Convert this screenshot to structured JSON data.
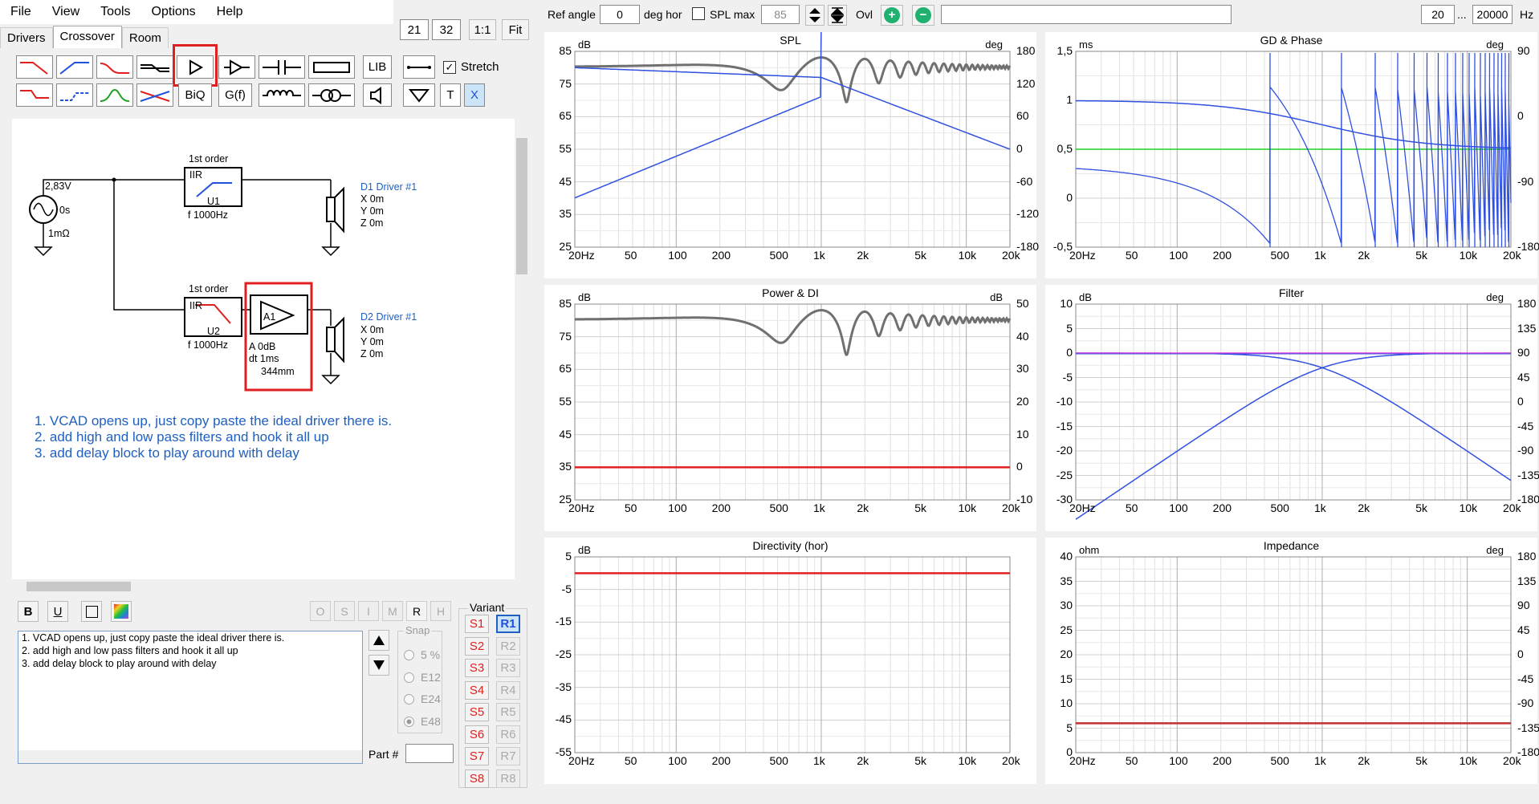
{
  "menu": [
    "File",
    "View",
    "Tools",
    "Options",
    "Help"
  ],
  "tabs": [
    "Drivers",
    "Crossover",
    "Room"
  ],
  "zoom": {
    "a": "21",
    "b": "32",
    "ratio": "1:1",
    "fit": "Fit"
  },
  "toolbar": {
    "lib": "LIB",
    "biq": "BiQ",
    "gf": "G(f)",
    "stretch": "Stretch",
    "t": "T",
    "x": "X"
  },
  "top": {
    "ref_angle_label": "Ref angle",
    "ref_angle_value": "0",
    "deg_hor": "deg hor",
    "spl_max_label": "SPL max",
    "spl_max_value": "85",
    "ovl": "Ovl",
    "f_min": "20",
    "dots": "...",
    "f_max": "20000",
    "hz": "Hz"
  },
  "schematic": {
    "src_v": "2,83V",
    "src_t": "0s",
    "src_r": "1mΩ",
    "u1_order": "1st order",
    "u1_type": "IIR",
    "u1_name": "U1",
    "u1_f": "f   1000Hz",
    "u2_order": "1st order",
    "u2_type": "IIR",
    "u2_name": "U2",
    "u2_f": "f   1000Hz",
    "a1_name": "A1",
    "a1_gain": "A  0dB",
    "a1_dt": "dt 1ms",
    "a1_dist": "344mm",
    "d1_name": "D1 Driver #1",
    "d2_name": "D2 Driver #1",
    "xyz": [
      "X 0m",
      "Y 0m",
      "Z 0m"
    ],
    "notes": [
      "1. VCAD opens up, just copy paste the ideal driver there is.",
      "2. add high and low pass filters and hook it all up",
      "3. add delay block to play around with delay"
    ]
  },
  "format_buttons": {
    "b": "B",
    "u": "U"
  },
  "osimrh": [
    "O",
    "S",
    "I",
    "M",
    "R",
    "H"
  ],
  "snap": {
    "label": "Snap",
    "options": [
      "5 %",
      "E12",
      "E24",
      "E48"
    ]
  },
  "part_label": "Part #",
  "variant": {
    "label": "Variant",
    "s": [
      "S1",
      "S2",
      "S3",
      "S4",
      "S5",
      "S6",
      "S7",
      "S8"
    ],
    "r": [
      "R1",
      "R2",
      "R3",
      "R4",
      "R5",
      "R6",
      "R7",
      "R8"
    ]
  },
  "freq_ticks": [
    "20Hz",
    "50",
    "100",
    "200",
    "500",
    "1k",
    "2k",
    "5k",
    "10k",
    "20k"
  ],
  "charts": {
    "spl": {
      "title": "SPL",
      "lu": "dB",
      "ru": "deg",
      "left": [
        "85",
        "75",
        "65",
        "55",
        "45",
        "35",
        "25"
      ],
      "right": [
        "180",
        "120",
        "60",
        "0",
        "-60",
        "-120",
        "-180"
      ]
    },
    "gd": {
      "title": "GD & Phase",
      "lu": "ms",
      "ru": "deg",
      "left": [
        "1,5",
        "1",
        "0,5",
        "0",
        "-0,5"
      ],
      "right": [
        "90",
        "0",
        "-90",
        "-180"
      ]
    },
    "pow": {
      "title": "Power & DI",
      "lu": "dB",
      "ru": "dB",
      "left": [
        "85",
        "75",
        "65",
        "55",
        "45",
        "35",
        "25"
      ],
      "right": [
        "50",
        "40",
        "30",
        "20",
        "10",
        "0",
        "-10"
      ]
    },
    "filt": {
      "title": "Filter",
      "lu": "dB",
      "ru": "deg",
      "left": [
        "10",
        "5",
        "0",
        "-5",
        "-10",
        "-15",
        "-20",
        "-25",
        "-30"
      ],
      "right": [
        "180",
        "135",
        "90",
        "45",
        "0",
        "-45",
        "-90",
        "-135",
        "-180"
      ]
    },
    "dir": {
      "title": "Directivity (hor)",
      "lu": "dB",
      "ru": "",
      "left": [
        "5",
        "-5",
        "-15",
        "-25",
        "-35",
        "-45",
        "-55"
      ],
      "right": []
    },
    "imp": {
      "title": "Impedance",
      "lu": "ohm",
      "ru": "deg",
      "left": [
        "40",
        "35",
        "30",
        "25",
        "20",
        "15",
        "10",
        "5",
        "0"
      ],
      "right": [
        "180",
        "135",
        "90",
        "45",
        "0",
        "-45",
        "-90",
        "-135",
        "-180"
      ]
    }
  },
  "chart_data": [
    {
      "type": "line",
      "title": "SPL",
      "xlabel": "",
      "ylabel": "dB",
      "xscale": "log",
      "xlim": [
        20,
        20000
      ],
      "ylim": [
        25,
        85
      ],
      "y2lim": [
        -180,
        180
      ],
      "series": [
        {
          "values_x": [
            20,
            200,
            500,
            700,
            1000,
            1200,
            2000,
            5000,
            20000
          ],
          "values_y": [
            80,
            78,
            79,
            83,
            79,
            63,
            80,
            80,
            80
          ]
        },
        {
          "values_x": [
            20,
            1000,
            20000
          ],
          "values_y": [
            46,
            77,
            55
          ]
        },
        {
          "values_x": [
            20,
            1000,
            20000
          ],
          "values_y": [
            80,
            77,
            55
          ]
        }
      ]
    },
    {
      "type": "line",
      "title": "GD & Phase",
      "xscale": "log",
      "xlim": [
        20,
        20000
      ],
      "ylim": [
        -0.5,
        1.5
      ],
      "series": [
        {
          "values_x": [
            20,
            1000,
            20000
          ],
          "values_y": [
            1.0,
            0.8,
            0.5
          ]
        },
        {
          "values_x": [
            20,
            20000
          ],
          "values_y": [
            0.5,
            0.5
          ]
        }
      ]
    },
    {
      "type": "line",
      "title": "Power & DI",
      "xscale": "log",
      "xlim": [
        20,
        20000
      ],
      "ylim": [
        25,
        85
      ],
      "y2lim": [
        -10,
        50
      ],
      "series": [
        {
          "values_x": [
            20,
            300,
            700,
            1000,
            1200,
            2000,
            20000
          ],
          "values_y": [
            80,
            76,
            83,
            79,
            63,
            80,
            80
          ]
        },
        {
          "values_x": [
            20,
            20000
          ],
          "values_y": [
            0,
            0
          ]
        }
      ]
    },
    {
      "type": "line",
      "title": "Filter",
      "xscale": "log",
      "xlim": [
        20,
        20000
      ],
      "ylim": [
        -30,
        10
      ],
      "y2lim": [
        -180,
        180
      ],
      "series": [
        {
          "values_x": [
            20,
            100,
            1000,
            5000,
            20000
          ],
          "values_y": [
            -34,
            -20,
            -3,
            0,
            0
          ]
        },
        {
          "values_x": [
            20,
            200,
            1000,
            10000,
            20000
          ],
          "values_y": [
            0,
            0,
            -3,
            -20,
            -26
          ]
        },
        {
          "values_x": [
            20,
            20000
          ],
          "values_y": [
            0,
            0
          ]
        }
      ]
    },
    {
      "type": "line",
      "title": "Directivity (hor)",
      "xscale": "log",
      "xlim": [
        20,
        20000
      ],
      "ylim": [
        -55,
        5
      ],
      "series": [
        {
          "values_x": [
            20,
            20000
          ],
          "values_y": [
            0,
            0
          ]
        }
      ]
    },
    {
      "type": "line",
      "title": "Impedance",
      "xscale": "log",
      "xlim": [
        20,
        20000
      ],
      "ylim": [
        0,
        40
      ],
      "y2lim": [
        -180,
        180
      ],
      "series": [
        {
          "values_x": [
            20,
            20000
          ],
          "values_y": [
            6,
            6
          ]
        }
      ]
    }
  ]
}
